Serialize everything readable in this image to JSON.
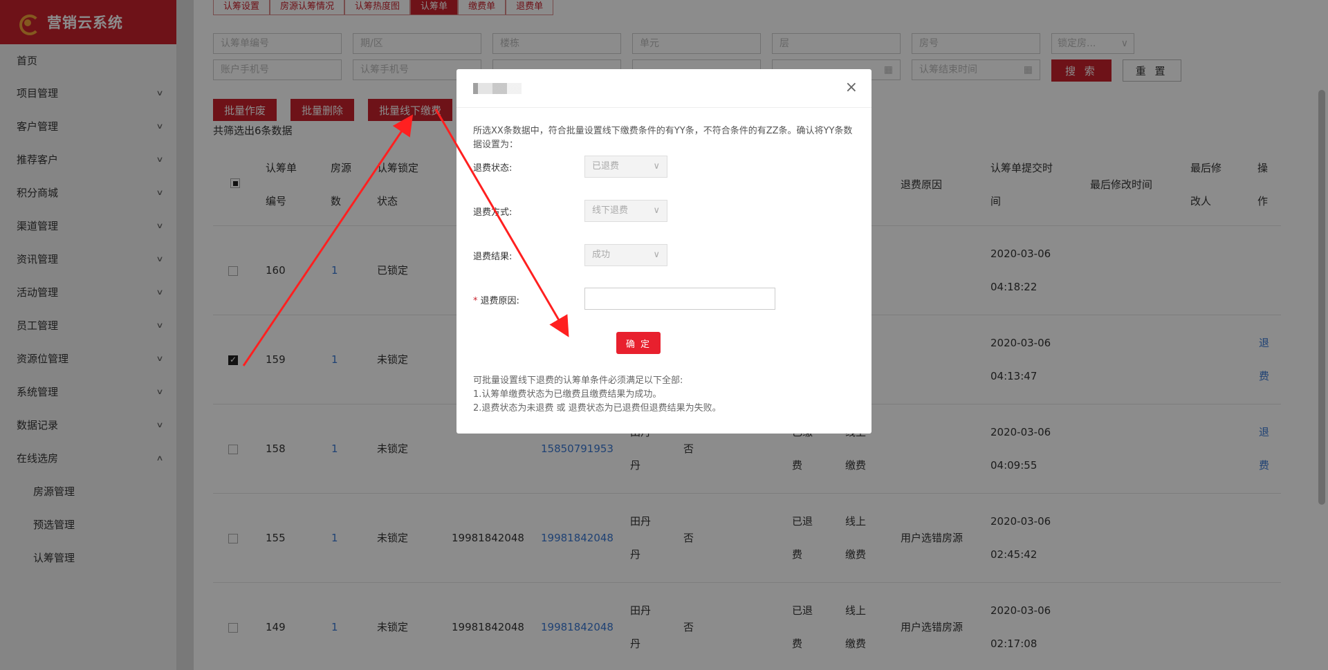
{
  "brand": {
    "name": "营销云系统"
  },
  "sidebar": {
    "home": "首页",
    "items": [
      {
        "label": "项目管理",
        "chevron": "∨"
      },
      {
        "label": "客户管理",
        "chevron": "∨"
      },
      {
        "label": "推荐客户",
        "chevron": "∨"
      },
      {
        "label": "积分商城",
        "chevron": "∨"
      },
      {
        "label": "渠道管理",
        "chevron": "∨"
      },
      {
        "label": "资讯管理",
        "chevron": "∨"
      },
      {
        "label": "活动管理",
        "chevron": "∨"
      },
      {
        "label": "员工管理",
        "chevron": "∨"
      },
      {
        "label": "资源位管理",
        "chevron": "∨"
      },
      {
        "label": "系统管理",
        "chevron": "∨"
      },
      {
        "label": "数据记录",
        "chevron": "∨"
      },
      {
        "label": "在线选房",
        "chevron": "∧"
      }
    ],
    "subitems": [
      "房源管理",
      "预选管理",
      "认筹管理"
    ]
  },
  "tabs": [
    "认筹设置",
    "房源认筹情况",
    "认筹热度图",
    "认筹单",
    "缴费单",
    "退费单"
  ],
  "filters": {
    "row1": [
      "认筹单编号",
      "期/区",
      "楼栋",
      "单元",
      "层",
      "房号"
    ],
    "row1_select": "锁定房...",
    "row2": [
      "账户手机号",
      "认筹手机号"
    ],
    "row2_end_date": "认筹结束时间",
    "search": "搜 索",
    "reset": "重 置"
  },
  "actions": {
    "batch_void": "批量作废",
    "batch_delete": "批量删除",
    "batch_offline_pay": "批量线下缴费"
  },
  "count_text": "共筛选出6条数据",
  "table": {
    "headers": {
      "id_a": "认筹单",
      "id_b": "编号",
      "src_a": "房源",
      "src_b": "数",
      "lock_a": "认筹锁定",
      "lock_b": "状态",
      "reason": "退费原因",
      "submit_a": "认筹单提交时",
      "submit_b": "间",
      "modified": "最后修改时间",
      "modifier_a": "最后修",
      "modifier_b": "改人",
      "op_a": "操",
      "op_b": "作"
    },
    "rows": [
      {
        "id": "160",
        "count": "1",
        "lock": "已锁定",
        "acct": "",
        "phone": "",
        "name_a": "",
        "name_b": "",
        "flag": "",
        "st_a": "",
        "st_b": "",
        "way_a": "",
        "way_b": "",
        "reason": "",
        "date": "2020-03-06",
        "time": "04:18:22",
        "op_a": "",
        "op_b": "",
        "checked": false
      },
      {
        "id": "159",
        "count": "1",
        "lock": "未锁定",
        "acct": "",
        "phone": "",
        "name_a": "",
        "name_b": "",
        "flag": "",
        "st_a": "",
        "st_b": "",
        "way_a": "",
        "way_b": "",
        "reason": "",
        "date": "2020-03-06",
        "time": "04:13:47",
        "op_a": "退",
        "op_b": "费",
        "checked": true
      },
      {
        "id": "158",
        "count": "1",
        "lock": "未锁定",
        "acct": "",
        "phone": "15850791953",
        "name_a": "田丹",
        "name_b": "丹",
        "flag": "否",
        "st_a": "已缴",
        "st_b": "费",
        "way_a": "线上",
        "way_b": "缴费",
        "reason": "",
        "date": "2020-03-06",
        "time": "04:09:55",
        "op_a": "退",
        "op_b": "费",
        "checked": false
      },
      {
        "id": "155",
        "count": "1",
        "lock": "未锁定",
        "acct": "19981842048",
        "phone": "19981842048",
        "name_a": "田丹",
        "name_b": "丹",
        "flag": "否",
        "st_a": "已退",
        "st_b": "费",
        "way_a": "线上",
        "way_b": "缴费",
        "reason": "用户选错房源",
        "date": "2020-03-06",
        "time": "02:45:42",
        "op_a": "",
        "op_b": "",
        "checked": false
      },
      {
        "id": "149",
        "count": "1",
        "lock": "未锁定",
        "acct": "19981842048",
        "phone": "19981842048",
        "name_a": "田丹",
        "name_b": "丹",
        "flag": "否",
        "st_a": "已退",
        "st_b": "费",
        "way_a": "线上",
        "way_b": "缴费",
        "reason": "用户选错房源",
        "date": "2020-03-06",
        "time": "02:17:08",
        "op_a": "",
        "op_b": "",
        "checked": false
      }
    ]
  },
  "modal": {
    "desc": "所选XX条数据中，符合批量设置线下缴费条件的有YY条，不符合条件的有ZZ条。确认将YY条数据设置为：",
    "refund_status_label": "退费状态:",
    "refund_status_value": "已退费",
    "refund_method_label": "退费方式:",
    "refund_method_value": "线下退费",
    "refund_result_label": "退费结果:",
    "refund_result_value": "成功",
    "reason_label": "退费原因:",
    "reason_required": "*",
    "confirm": "确 定",
    "close": "×",
    "note_1": "可批量设置线下退费的认筹单条件必须满足以下全部:",
    "note_2": "1.认筹单缴费状态为已缴费且缴费结果为成功。",
    "note_3": "2.退费状态为未退费 或 退费状态为已退费但退费结果为失败。"
  },
  "colors": {
    "brand": "#c8222d",
    "link": "#3a78d4",
    "arrow": "#ff2020"
  }
}
